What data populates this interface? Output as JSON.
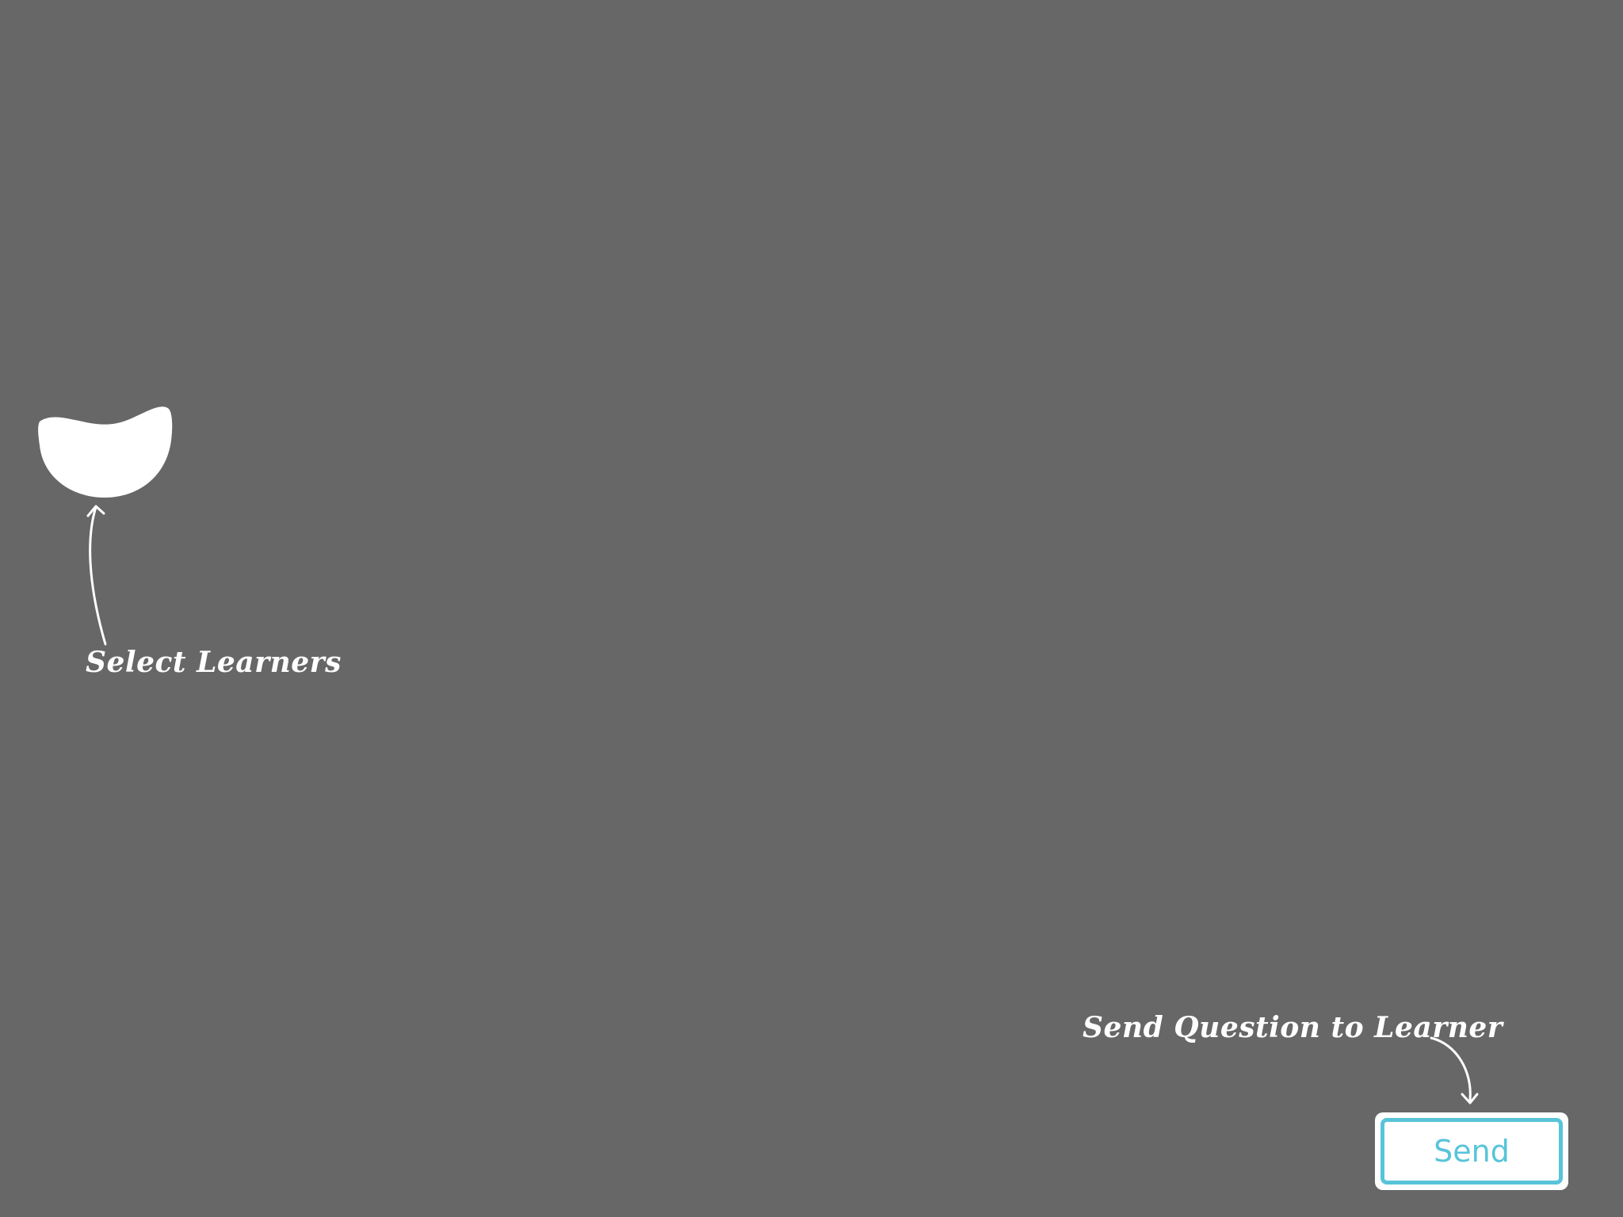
{
  "hints": {
    "select_learners": "Select Learners",
    "send_question": "Send Question to Learner"
  },
  "buttons": {
    "send_label": "Send"
  },
  "icons": {
    "learner_selector": "learner-selector-icon",
    "hint_arrow": "curved-arrow-icon"
  },
  "colors": {
    "background": "#676767",
    "accent": "#58c4d9",
    "foreground": "#ffffff"
  }
}
